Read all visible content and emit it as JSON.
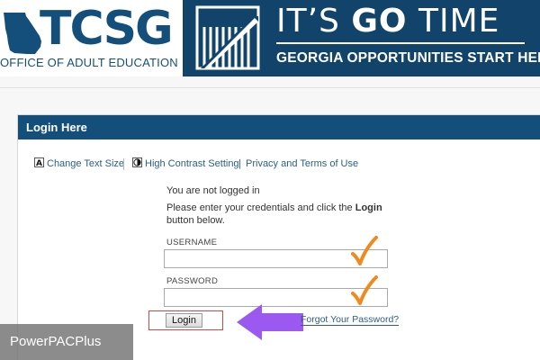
{
  "banner": {
    "org_logo_text": "TCSG",
    "org_subtitle": "OFFICE OF ADULT EDUCATION",
    "tagline_prefix": "IT’S ",
    "tagline_bold": "GO",
    "tagline_suffix": " TIME",
    "tagline_sub": "GEORGIA OPPORTUNITIES START HERE"
  },
  "panel": {
    "title": "Login Here"
  },
  "toolbar": {
    "change_text_size": "Change Text Size",
    "high_contrast": "High Contrast Setting",
    "pipe": "|",
    "privacy": "Privacy and Terms of Use"
  },
  "form": {
    "status": "You are not logged in",
    "instruction_prefix": "Please enter your credentials and click the ",
    "instruction_bold": "Login",
    "instruction_suffix": "button below.",
    "username_label": "USERNAME",
    "username_value": "",
    "password_label": "PASSWORD",
    "password_value": "",
    "login_button": "Login",
    "forgot_link": "Forgot Your Password?"
  },
  "annotations": {
    "check_color": "#f08a1c",
    "arrow_color": "#9b59f2",
    "highlight_color": "#d64545"
  },
  "watermark": "PowerPACPlus",
  "colors": {
    "header_blue": "#134f7a",
    "banner_navy": "#12446b",
    "link_blue": "#2a5d8a"
  }
}
